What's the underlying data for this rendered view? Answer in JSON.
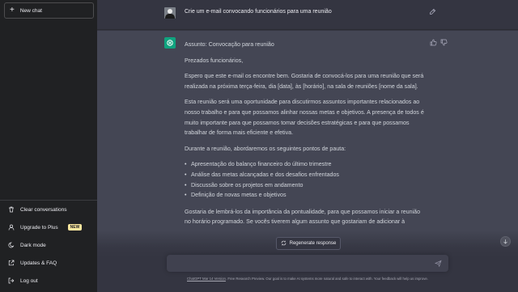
{
  "sidebar": {
    "new_chat_label": "New chat",
    "items": [
      {
        "label": "Clear conversations",
        "icon": "trash-icon"
      },
      {
        "label": "Upgrade to Plus",
        "icon": "user-icon",
        "badge": "NEW"
      },
      {
        "label": "Dark mode",
        "icon": "moon-icon"
      },
      {
        "label": "Updates & FAQ",
        "icon": "external-link-icon"
      },
      {
        "label": "Log out",
        "icon": "logout-icon"
      }
    ]
  },
  "chat": {
    "user_message": "Crie um e-mail convocando funcionários para uma reunião",
    "assistant": {
      "subject": "Assunto: Convocação para reunião",
      "greeting": "Prezados funcionários,",
      "p1": "Espero que este e-mail os encontre bem. Gostaria de convocá-los para uma reunião que será realizada na próxima terça-feira, dia [data], às [horário], na sala de reuniões [nome da sala].",
      "p2": "Esta reunião será uma oportunidade para discutirmos assuntos importantes relacionados ao nosso trabalho e para que possamos alinhar nossas metas e objetivos. A presença de todos é muito importante para que possamos tomar decisões estratégicas e para que possamos trabalhar de forma mais eficiente e efetiva.",
      "p3": "Durante a reunião, abordaremos os seguintes pontos de pauta:",
      "bullets": [
        "Apresentação do balanço financeiro do último trimestre",
        "Análise das metas alcançadas e dos desafios enfrentados",
        "Discussão sobre os projetos em andamento",
        "Definição de novas metas e objetivos"
      ],
      "p4": "Gostaria de lembrá-los da importância da pontualidade, para que possamos iniciar a reunião no horário programado. Se vocês tiverem algum assunto que gostariam de adicionar à"
    }
  },
  "regenerate_label": "Regenerate response",
  "footer": {
    "link": "ChatGPT Mar 14 Version",
    "text": ". Free Research Preview. Our goal is to make AI systems more natural and safe to interact with. Your feedback will help us improve."
  },
  "colors": {
    "sidebar_bg": "#202123",
    "main_bg": "#343541",
    "assistant_bg": "#444654",
    "brand_green": "#10a37f",
    "badge": "#fae69e"
  }
}
